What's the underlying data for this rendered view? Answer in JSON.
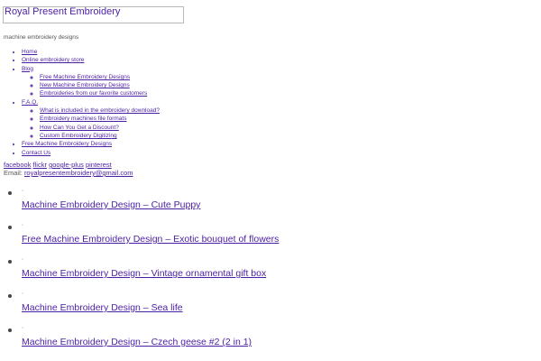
{
  "site": {
    "title": "Royal Present Embroidery",
    "tagline": "machine embroidery designs"
  },
  "nav": {
    "items": [
      {
        "label": "Home"
      },
      {
        "label": "Online embroidery store"
      },
      {
        "label": "Blog",
        "children": [
          {
            "label": "Free Machine Embroidery Designs"
          },
          {
            "label": "New Machine Embroidery Designs"
          },
          {
            "label": "Embroideries from our favorite customers"
          }
        ]
      },
      {
        "label": "F.A.Q.",
        "children": [
          {
            "label": "What is included in the embroidery download?"
          },
          {
            "label": "Embroidery machines file formats"
          },
          {
            "label": "How Can You Get a Discount?"
          },
          {
            "label": "Custom Embroidery Digitizing"
          }
        ]
      },
      {
        "label": "Free Machine Embroidery Designs"
      },
      {
        "label": "Contact Us"
      }
    ]
  },
  "social": {
    "links": [
      "facebook",
      "flickr",
      "google-plus",
      "pinterest"
    ]
  },
  "contact": {
    "email_label": "Email:",
    "email": "royalpresentembroidery@gmail.com"
  },
  "posts": [
    {
      "thumb": "◦",
      "title": "Machine Embroidery Design – Cute Puppy"
    },
    {
      "thumb": "◦",
      "title": "Free Machine Embroidery Design – Exotic bouquet of flowers"
    },
    {
      "thumb": "◦",
      "title": "Machine Embroidery Design – Vintage ornamental gift box"
    },
    {
      "thumb": "◦",
      "title": "Machine Embroidery Design – Sea life"
    },
    {
      "thumb": "◦",
      "title": "Machine Embroidery Design – Czech geese #2 (2 in 1)"
    }
  ],
  "colors": {
    "link": "#4b1fa3",
    "text": "#444444",
    "border": "#b9b9b9"
  }
}
